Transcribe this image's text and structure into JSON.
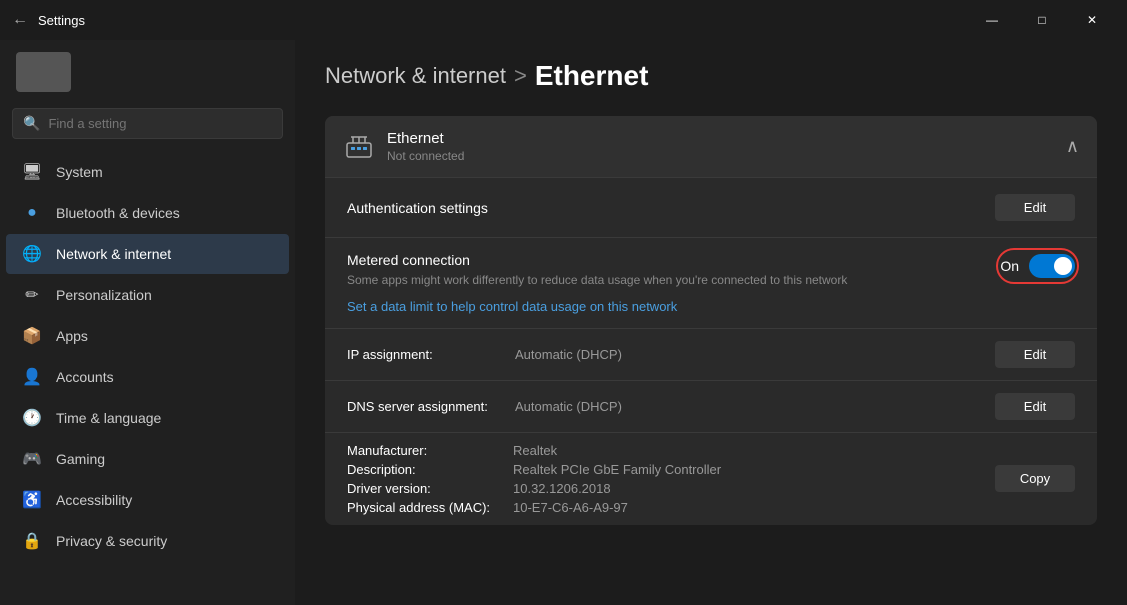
{
  "titlebar": {
    "title": "Settings",
    "back_icon": "←",
    "min_icon": "—",
    "max_icon": "□",
    "close_icon": "✕"
  },
  "sidebar": {
    "search_placeholder": "Find a setting",
    "nav_items": [
      {
        "id": "system",
        "label": "System",
        "icon": "🖥",
        "active": false
      },
      {
        "id": "bluetooth",
        "label": "Bluetooth & devices",
        "icon": "🔵",
        "active": false
      },
      {
        "id": "network",
        "label": "Network & internet",
        "icon": "🌐",
        "active": true
      },
      {
        "id": "personalization",
        "label": "Personalization",
        "icon": "✏",
        "active": false
      },
      {
        "id": "apps",
        "label": "Apps",
        "icon": "📦",
        "active": false
      },
      {
        "id": "accounts",
        "label": "Accounts",
        "icon": "👤",
        "active": false
      },
      {
        "id": "time",
        "label": "Time & language",
        "icon": "🕐",
        "active": false
      },
      {
        "id": "gaming",
        "label": "Gaming",
        "icon": "🎮",
        "active": false
      },
      {
        "id": "accessibility",
        "label": "Accessibility",
        "icon": "♿",
        "active": false
      },
      {
        "id": "privacy",
        "label": "Privacy & security",
        "icon": "🔒",
        "active": false
      }
    ]
  },
  "breadcrumb": {
    "parent": "Network & internet",
    "separator": ">",
    "current": "Ethernet"
  },
  "panel": {
    "title": "Ethernet",
    "subtitle": "Not connected",
    "authentication_settings_label": "Authentication settings",
    "edit_label": "Edit",
    "metered_connection": {
      "title": "Metered connection",
      "description": "Some apps might work differently to reduce data usage when you're connected to this network",
      "link": "Set a data limit to help control data usage on this network",
      "toggle_label": "On",
      "toggle_on": true
    },
    "ip_assignment": {
      "key": "IP assignment:",
      "value": "Automatic (DHCP)",
      "edit_label": "Edit"
    },
    "dns_assignment": {
      "key": "DNS server assignment:",
      "value": "Automatic (DHCP)",
      "edit_label": "Edit"
    },
    "device_info": {
      "manufacturer_key": "Manufacturer:",
      "manufacturer_val": "Realtek",
      "description_key": "Description:",
      "description_val": "Realtek PCIe GbE Family Controller",
      "driver_key": "Driver version:",
      "driver_val": "10.32.1206.2018",
      "mac_key": "Physical address (MAC):",
      "mac_val": "10-E7-C6-A6-A9-97",
      "copy_label": "Copy"
    }
  }
}
